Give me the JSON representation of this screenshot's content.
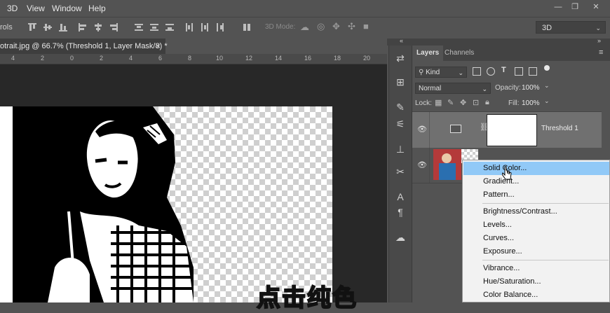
{
  "menubar": {
    "items": [
      "3D",
      "View",
      "Window",
      "Help"
    ]
  },
  "window_controls": {
    "minimize": "—",
    "restore": "❐",
    "close": "✕"
  },
  "options_bar": {
    "tool_label": "rols",
    "mode_3d_label": "3D Mode:",
    "workspace_value": "3D"
  },
  "document": {
    "tab_title": "otrait.jpg @ 66.7% (Threshold 1, Layer Mask/8) *",
    "tab_close": "×",
    "ruler_numbers": [
      "4",
      "2",
      "0",
      "2",
      "4",
      "6",
      "8",
      "10",
      "12",
      "14",
      "16",
      "18",
      "20"
    ]
  },
  "layers_panel": {
    "tabs": [
      "Layers",
      "Channels"
    ],
    "kind_filter": "Kind",
    "blend_mode": "Normal",
    "opacity_label": "Opacity:",
    "opacity_value": "100%",
    "lock_label": "Lock:",
    "fill_label": "Fill:",
    "fill_value": "100%",
    "layers": [
      {
        "name": "Threshold 1",
        "selected": true,
        "visible": true
      },
      {
        "name": "",
        "selected": false,
        "visible": true
      }
    ]
  },
  "context_menu": {
    "items": [
      {
        "label": "Solid Color...",
        "highlighted": true
      },
      {
        "label": "Gradient...",
        "highlighted": false
      },
      {
        "label": "Pattern...",
        "highlighted": false
      },
      {
        "label": "Brightness/Contrast...",
        "highlighted": false
      },
      {
        "label": "Levels...",
        "highlighted": false
      },
      {
        "label": "Curves...",
        "highlighted": false
      },
      {
        "label": "Exposure...",
        "highlighted": false
      },
      {
        "label": "Vibrance...",
        "highlighted": false
      },
      {
        "label": "Hue/Saturation...",
        "highlighted": false
      },
      {
        "label": "Color Balance...",
        "highlighted": false
      }
    ]
  },
  "caption": "点击纯色",
  "colors": {
    "ui_bg": "#535353",
    "menu_highlight": "#91c9f7",
    "canvas_bg": "#282828"
  }
}
